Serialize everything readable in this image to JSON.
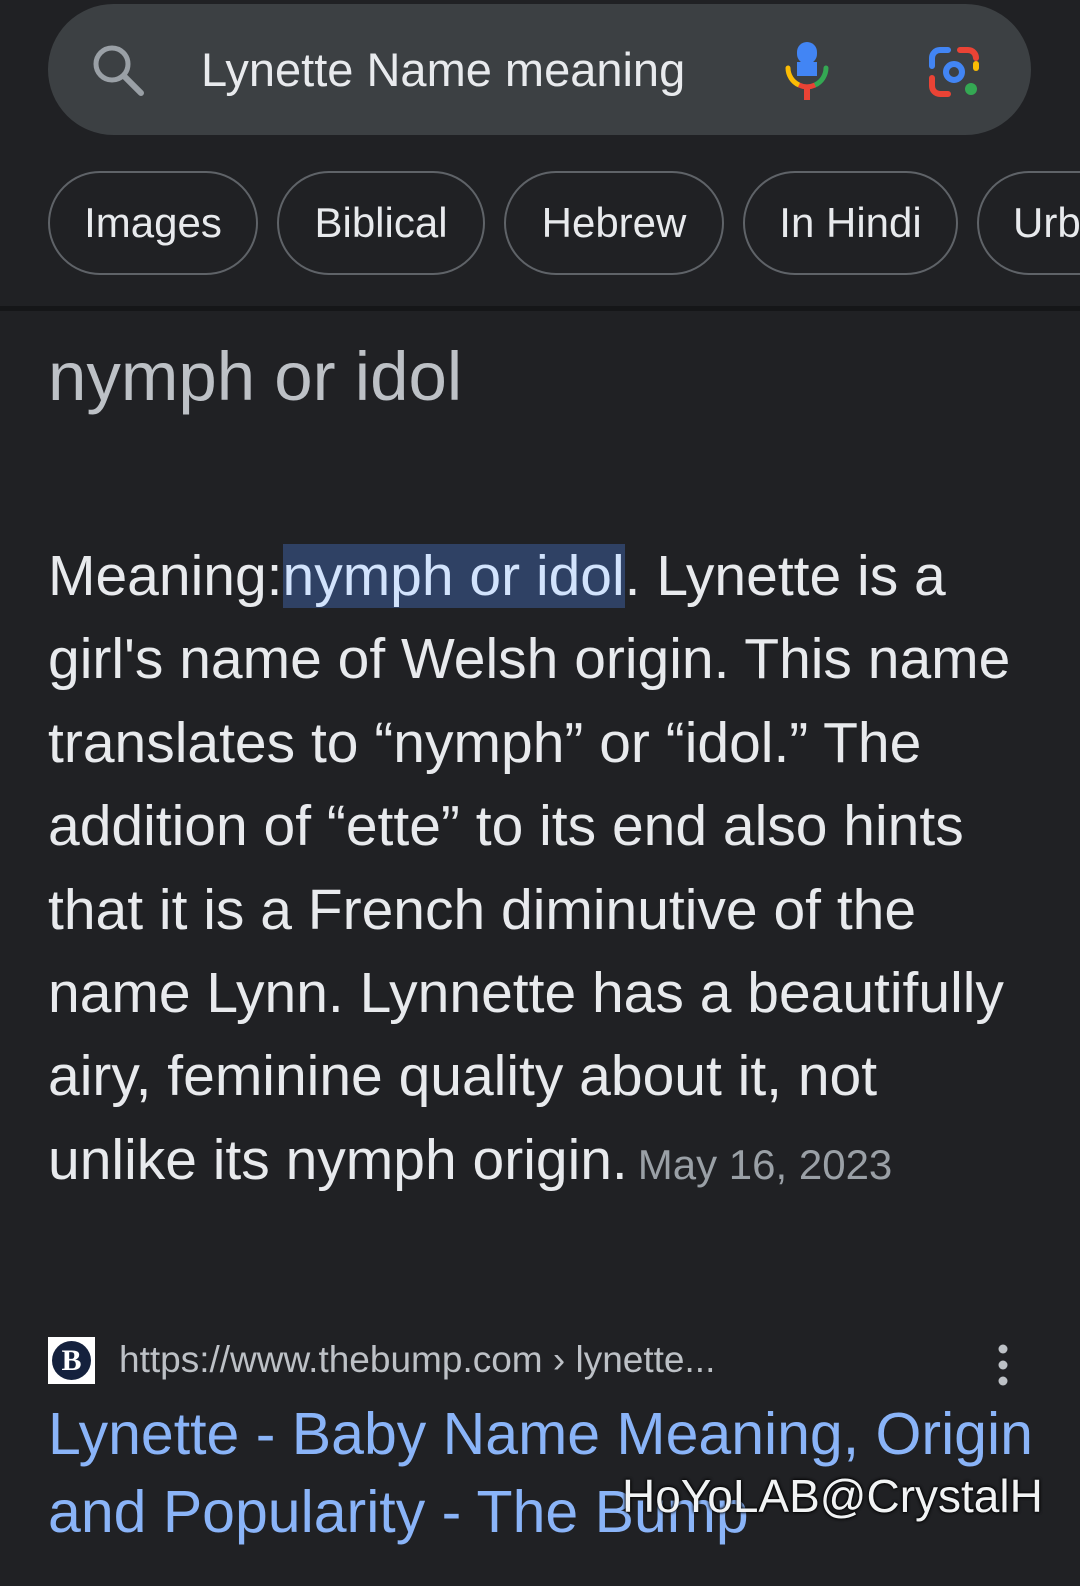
{
  "search": {
    "query": "Lynette Name meaning"
  },
  "chips": [
    {
      "label": "Images"
    },
    {
      "label": "Biblical"
    },
    {
      "label": "Hebrew"
    },
    {
      "label": "In Hindi"
    },
    {
      "label": "Urb"
    }
  ],
  "answer": {
    "headline": "nymph or idol",
    "snippet_prefix": "Meaning:",
    "snippet_highlight": "nymph or idol",
    "snippet_body": ". Lynette is a girl's name of Welsh origin. This name translates to “nymph” or “idol.” The addition of “ette” to its end also hints that it is a French diminutive of the name Lynn. Lynnette has a beautifully airy, feminine quality about it, not unlike its nymph origin.",
    "date": "May 16, 2023"
  },
  "result": {
    "favicon_letter": "B",
    "url": "https://www.thebump.com › lynette...",
    "title": "Lynette - Baby Name Meaning, Origin and Popularity - The Bump"
  },
  "watermark": "HoYoLAB@CrystalH",
  "icons": {
    "search": "search-icon",
    "mic": "mic-icon",
    "lens": "google-lens-icon",
    "more": "more-vert-icon"
  },
  "colors": {
    "background": "#202124",
    "search_bar": "#3c4043",
    "link": "#8ab4f8",
    "highlight": "#2f4164"
  }
}
